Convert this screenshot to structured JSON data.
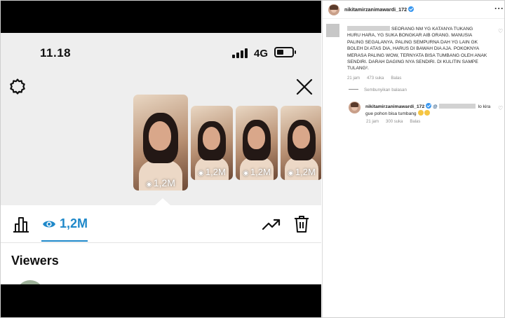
{
  "phone": {
    "status_time": "11.18",
    "network": "4G",
    "stories": [
      {
        "views": "1,2M"
      },
      {
        "views": "1,2M"
      },
      {
        "views": "1,2M"
      },
      {
        "views": "1,2M"
      }
    ],
    "views_count": "1,2M",
    "viewers_title": "Viewers",
    "accent_color": "#1e88c9"
  },
  "ig": {
    "post_author": "nikitamirzanimawardi_172",
    "comment": {
      "text": "SEORANG NM YG KATANYA TUKANG HURU HARA, YG SUKA BONGKAR AIB ORANG. MANUSIA PALING SEGALANYA. PALING SEMPURNA DAH YG LAIN GK BOLEH DI ATAS DIA, HARUS DI BAWAH DIA AJA. POKOKNYA MERASA PALING WOW, TERNYATA BISA TUMBANG OLEH ANAK SENDIRI. DARAH DAGING NYA SENDIRI. DI KULITIN SAMPE TULANG².",
      "time": "21 jam",
      "likes": "473 suka",
      "reply": "Balas"
    },
    "hide_replies": "Sembunyikan balasan",
    "reply": {
      "author": "nikitamirzanimawardi_172",
      "at": "@",
      "text_after_mention": "lo kira gue pohon bisa tumbang",
      "time": "21 jam",
      "likes": "300 suka",
      "reply": "Balas"
    }
  }
}
